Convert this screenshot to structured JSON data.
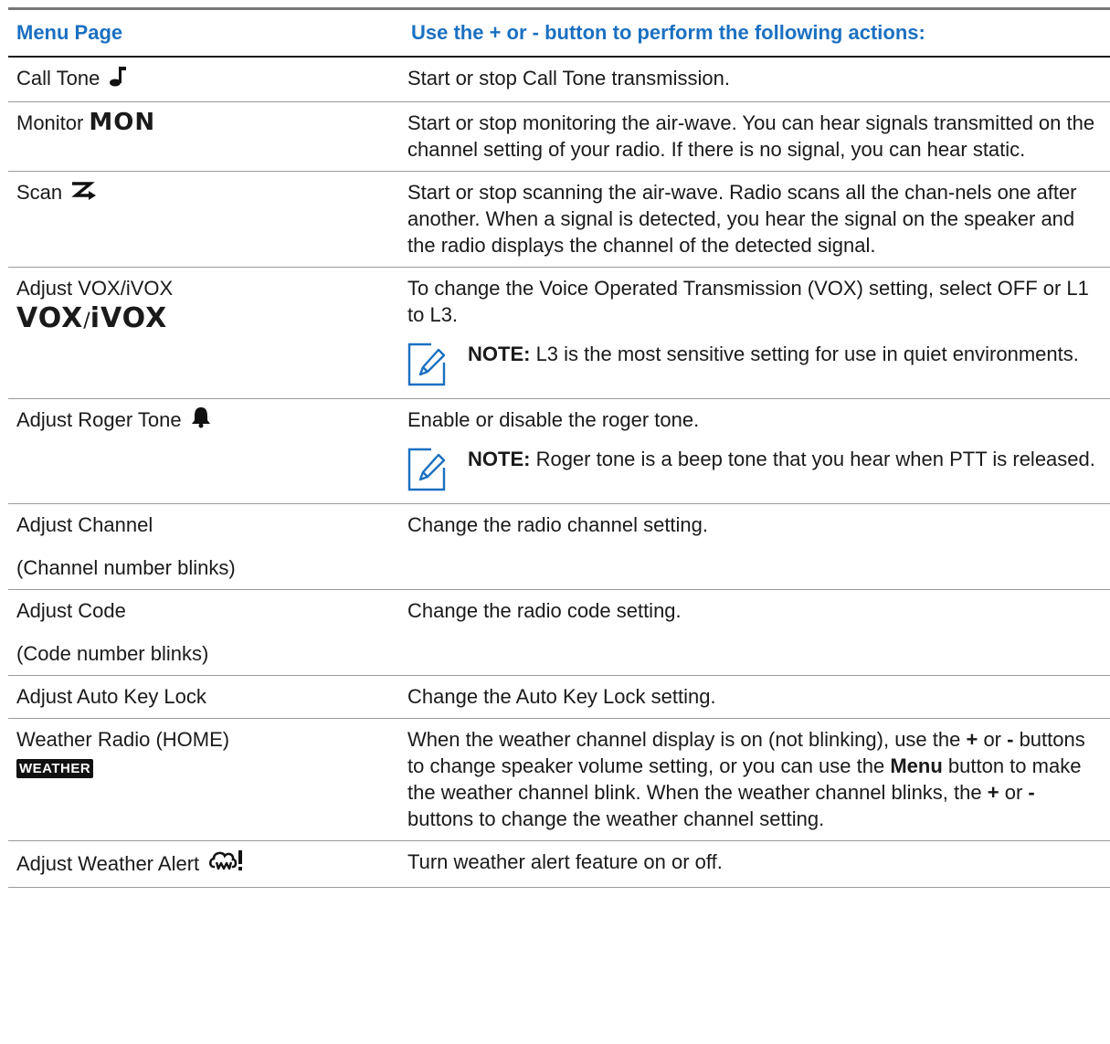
{
  "header": {
    "col1": "Menu Page",
    "col2": "Use the + or - button to perform the following actions:"
  },
  "rows": [
    {
      "menu": "Call Tone",
      "icon": "music-note-icon",
      "action": "Start or stop Call Tone transmission."
    },
    {
      "menu": "Monitor",
      "icon_text": "MON",
      "action": "Start or stop monitoring the air-wave. You can hear signals transmitted on the channel setting of your radio. If there is no signal, you can hear static."
    },
    {
      "menu": "Scan",
      "icon": "scan-icon",
      "action": "Start or stop scanning the air-wave. Radio scans all the chan-nels one after another. When a signal is detected, you hear the signal on the speaker and the radio displays the channel of the detected signal."
    },
    {
      "menu": "Adjust VOX/iVOX",
      "icon_text_a": "VOX",
      "icon_text_sep": "/",
      "icon_text_b": "iVOX",
      "action": "To change the Voice Operated Transmission (VOX) setting, select OFF or L1 to L3.",
      "note_label": "NOTE:",
      "note": " L3 is the most sensitive setting for use in quiet environments."
    },
    {
      "menu": "Adjust Roger Tone",
      "icon": "bell-icon",
      "action": "Enable or disable the roger tone.",
      "note_label": "NOTE:",
      "note": " Roger tone is a beep tone that you hear when PTT is released."
    },
    {
      "menu": "Adjust Channel",
      "sub": "(Channel number blinks)",
      "action": "Change the radio channel setting."
    },
    {
      "menu": "Adjust Code",
      "sub": "(Code number blinks)",
      "action": "Change the radio code setting."
    },
    {
      "menu": "Adjust Auto Key Lock",
      "action": "Change the Auto Key Lock setting."
    },
    {
      "menu": "Weather Radio (HOME)",
      "icon_text": "WEATHER",
      "action_parts": [
        "When the weather channel display is on (not blinking), use the ",
        "+",
        " or ",
        "-",
        " buttons to change speaker volume setting, or you can use the ",
        "Menu",
        " button to make the weather channel blink. When the weather channel blinks, the ",
        "+",
        " or ",
        "-",
        " buttons to change the weather channel setting."
      ]
    },
    {
      "menu": "Adjust Weather Alert",
      "icon": "weather-alert-icon",
      "action": "Turn weather alert feature on or off."
    }
  ]
}
